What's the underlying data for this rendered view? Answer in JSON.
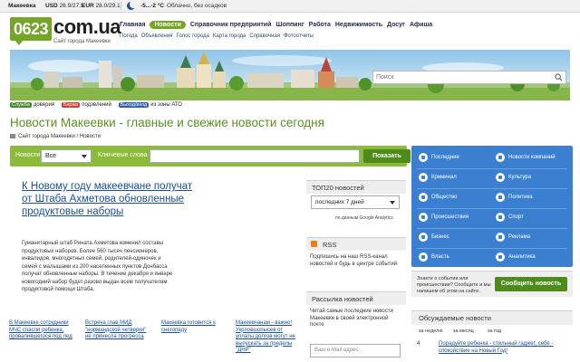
{
  "topbar": {
    "city": "Макеевка",
    "usd_label": "USD",
    "usd_value": "26.9/27.5",
    "eur_label": "EUR",
    "eur_value": "28.0/29.1",
    "temp": "-5...-2 °C",
    "weather": "Облачно, без осадков"
  },
  "logo": {
    "code": "0623",
    "domain": "com.ua",
    "subtitle": "Сайт города Макеевки"
  },
  "nav": {
    "items": [
      "Главная",
      "Новости",
      "Справочник предприятий",
      "Шоппинг",
      "Работа",
      "Недвижимость",
      "Досуг",
      "Афиша"
    ],
    "active_index": 1
  },
  "subnav": {
    "items": [
      "Погода",
      "Объявления",
      "Голос города",
      "Карта города",
      "Справочная",
      "Фотоотчеты"
    ]
  },
  "search": {
    "placeholder": "Поиск"
  },
  "legend": [
    {
      "tag": "Служба",
      "text": "доверия",
      "color": "#3f8f2a"
    },
    {
      "tag": "Биржа",
      "text": "подзвлений",
      "color": "#d43c2c"
    },
    {
      "tag": "Выход/вход",
      "text": "из зоны АТО",
      "color": "#2b5fb8"
    }
  ],
  "page": {
    "heading": "Новости Макеевки - главные и свежие новости сегодня",
    "breadcrumb": "Сайт города Макеевки / Новости"
  },
  "filter": {
    "news_label": "Новости",
    "select_value": "Все",
    "keywords_label": "Ключевые слова",
    "show_button": "Показать"
  },
  "article": {
    "title": "К Новому году макеевчане получат от Штаба Ахметова обновленные продуктовые наборы",
    "body": "Гуманитарный штаб Рината Ахметова изменил составы продуктовых наборов. Более 560 тысяч пенсионеров, инвалидов, многодетных семей, родителей-одиночек и семей с малышами из 200 населенных пунктов Донбасса получат обновленные наборы. В течение декабря и январе новогодний набор будет разово выдан всем получателям продуктовой помощи Штаба."
  },
  "bottom_links": [
    "В Макеевке сотрудники МЧС спасли ребенка, провалившегося под лед",
    "Встреча глав МИД \"нормандской четверки\" не принесла прогресса",
    "Макеевка готовится к снегопаду",
    "Макеевчанам - важно! Укрповшопысев от уплаты долгов могут не выпускать за пределы \"ДНР\""
  ],
  "top20": {
    "title": "ТОП20 новостей",
    "select_value": "последних 7 дней",
    "analytics_note": "по данным Google Analytics"
  },
  "rss": {
    "title": "RSS",
    "text": "Подпишись на наш RSS-канал новостей и будь в центре событий"
  },
  "mailing": {
    "title": "Рассылка новостей",
    "text": "Читай самые последние новости Макеевки в своей электронной почте",
    "email_placeholder": "Ваш e-Mail адрес"
  },
  "categories": {
    "left": [
      "Последние",
      "Криминал",
      "Общество",
      "Происшествия",
      "Бизнес",
      "Власть"
    ],
    "right": [
      "Новости компаний",
      "Культура",
      "Политика",
      "Спорт",
      "Реклама",
      "Аналитика"
    ]
  },
  "submit_news": {
    "text": "Знаете о событии или происшествии? Сообщите и мы напишем об этом на сайте.",
    "button": "Сообщить новость"
  },
  "discussed": {
    "title": "Обсуждаемые новости",
    "tabs": [
      "за неделю",
      "за месяц",
      "за год"
    ],
    "items": [
      {
        "count": "4",
        "text": "Порадуйте ребенка - стильный гаджет, себе - спокойствие на Новый Год!"
      }
    ]
  }
}
